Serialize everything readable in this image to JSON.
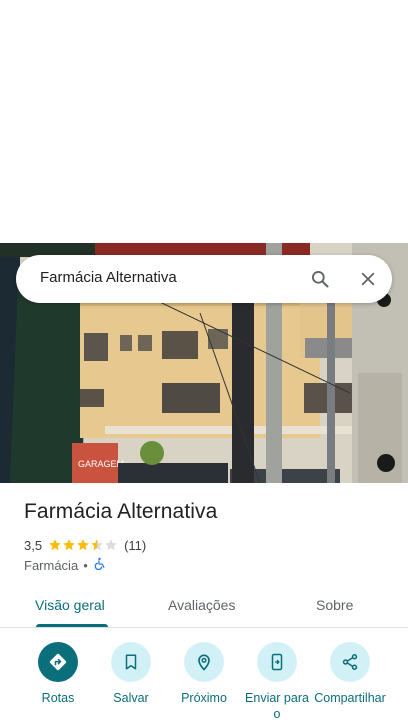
{
  "search": {
    "query": "Farmácia Alternativa",
    "search_icon": "search-icon",
    "close_icon": "close-icon"
  },
  "photo": {
    "sign_text": "GARAGEM"
  },
  "place": {
    "name": "Farmácia Alternativa",
    "rating": "3,5",
    "rating_stars": 3.5,
    "review_count": "(11)",
    "category": "Farmácia",
    "separator": "•",
    "accessibility_icon": "wheelchair-icon"
  },
  "tabs": [
    {
      "label": "Visão geral",
      "active": true
    },
    {
      "label": "Avaliações",
      "active": false
    },
    {
      "label": "Sobre",
      "active": false
    }
  ],
  "actions": [
    {
      "label": "Rotas",
      "icon": "directions-icon"
    },
    {
      "label": "Salvar",
      "icon": "bookmark-icon"
    },
    {
      "label": "Próximo",
      "icon": "nearby-icon"
    },
    {
      "label": "Enviar para o",
      "icon": "send-to-phone-icon"
    },
    {
      "label": "Compartilhar",
      "icon": "share-icon"
    }
  ],
  "colors": {
    "accent": "#0b6e7b",
    "accent_light": "#d2f1f7",
    "star": "#fbbc04",
    "accessibility_blue": "#1a73e8"
  }
}
